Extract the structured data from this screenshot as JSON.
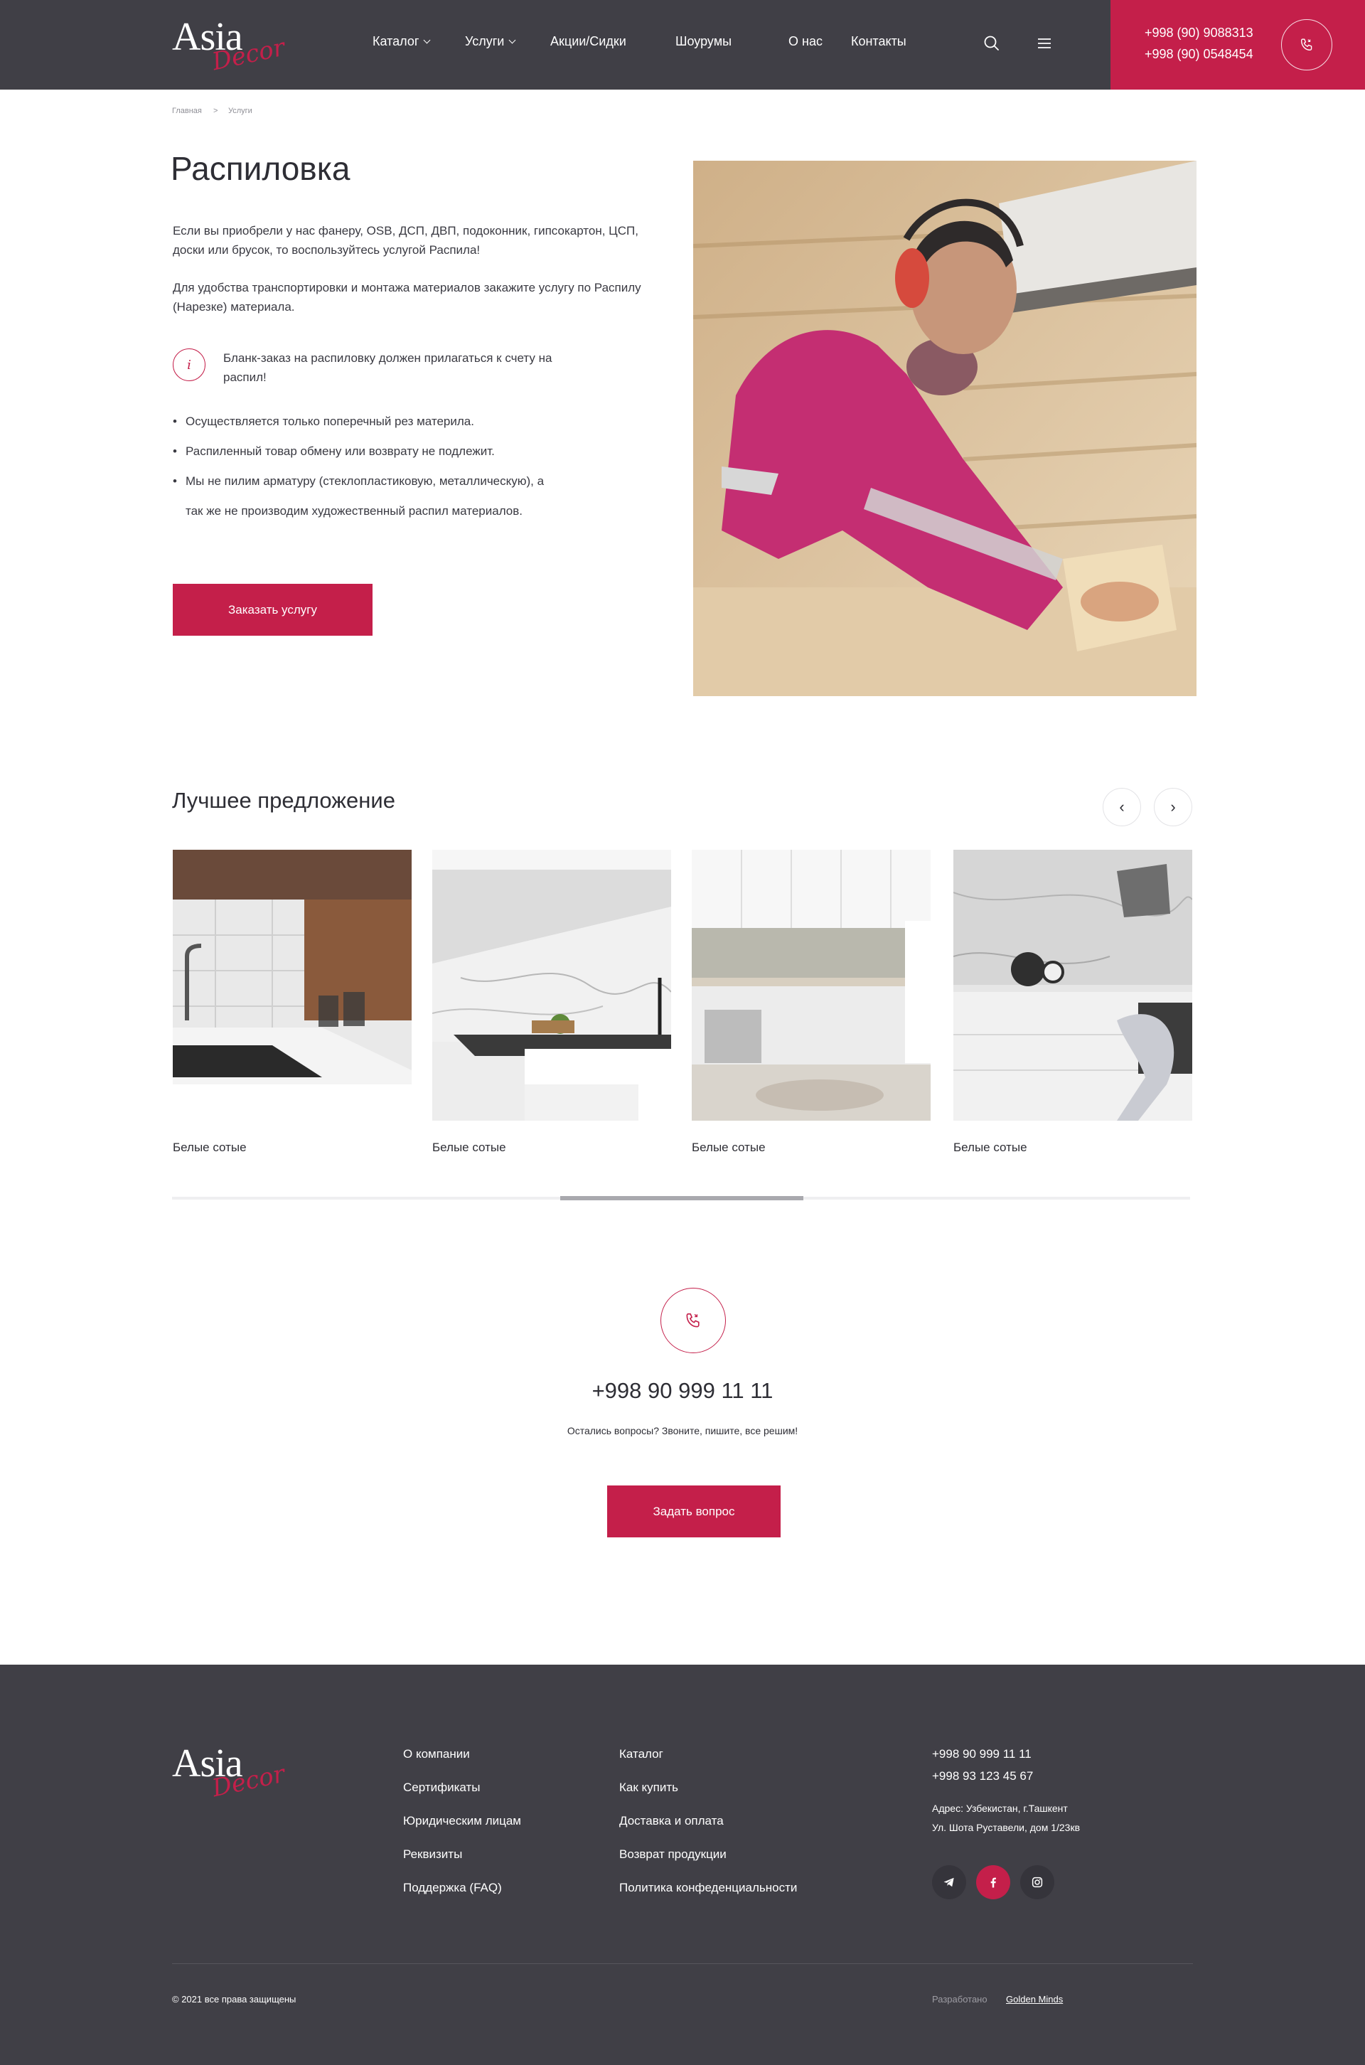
{
  "header": {
    "logo": {
      "primary": "Asia",
      "secondary": "Decor"
    },
    "nav": [
      {
        "label": "Каталог",
        "dropdown": true
      },
      {
        "label": "Услуги",
        "dropdown": true
      },
      {
        "label": "Акции/Сидки",
        "dropdown": false
      },
      {
        "label": "Шоурумы",
        "dropdown": false
      },
      {
        "label": "О нас",
        "dropdown": false
      },
      {
        "label": "Контакты",
        "dropdown": false
      }
    ],
    "phones": [
      "+998 (90) 9088313",
      "+998 (90) 0548454"
    ],
    "icons": {
      "search": "search-icon",
      "menu": "hamburger-menu-icon",
      "call": "phone-icon"
    }
  },
  "breadcrumb": {
    "items": [
      "Главная",
      "Услуги"
    ],
    "separator": ">"
  },
  "hero": {
    "title": "Распиловка",
    "paragraphs": [
      "Если вы приобрели у нас фанеру, OSB, ДСП, ДВП, подоконник, гипсокартон, ЦСП, доски или брусок, то воспользуйтесь услугой Распила!",
      "Для удобства транспортировки и монтажа материалов закажите услугу по Распилу (Нарезке) материала."
    ],
    "info_icon": "i",
    "info": "Бланк-заказ на распиловку должен прилагаться к счету на распил!",
    "bullets": [
      "Осуществляется только поперечный рез материла.",
      "Распиленный товар обмену или возврату не подлежит.",
      "Мы не пилим арматуру (стеклопластиковую, металлическую), а"
    ],
    "bullet_continuation": "так же не производим художественный распил материалов.",
    "button": "Заказать услугу"
  },
  "offers": {
    "title": "Лучшее предложение",
    "prev": "‹",
    "next": "›",
    "items": [
      {
        "label": "Белые сотые"
      },
      {
        "label": "Белые сотые"
      },
      {
        "label": "Белые сотые"
      },
      {
        "label": "Белые сотые"
      }
    ],
    "scroll_position": 0.38
  },
  "contact": {
    "phone": "+998 90 999 11 11",
    "subtitle": "Остались вопросы? Звоните, пишите, все решим!",
    "button": "Задать вопрос"
  },
  "footer": {
    "logo": {
      "primary": "Asia",
      "secondary": "Decor"
    },
    "col1": [
      "О компании",
      "Сертификаты",
      "Юридическим лицам",
      "Реквизиты",
      "Поддержка (FAQ)"
    ],
    "col2": [
      "Каталог",
      "Как купить",
      "Доставка и оплата",
      "Возврат продукции",
      "Политика конфеденциальности"
    ],
    "phones": [
      "+998 90 999 11 11",
      "+998 93 123 45 67"
    ],
    "address": [
      "Адрес: Узбекистан, г.Ташкент",
      "Ул. Шота Руставели, дом 1/23кв"
    ],
    "social": [
      "telegram-icon",
      "facebook-icon",
      "instagram-icon"
    ],
    "copyright": "© 2021 все права защищены",
    "developed_label": "Разработано",
    "developer": "Golden Minds"
  },
  "colors": {
    "accent": "#c41f4a",
    "header_bg": "#403f46",
    "footer_bg": "#403f46",
    "text": "#2e2e35"
  }
}
